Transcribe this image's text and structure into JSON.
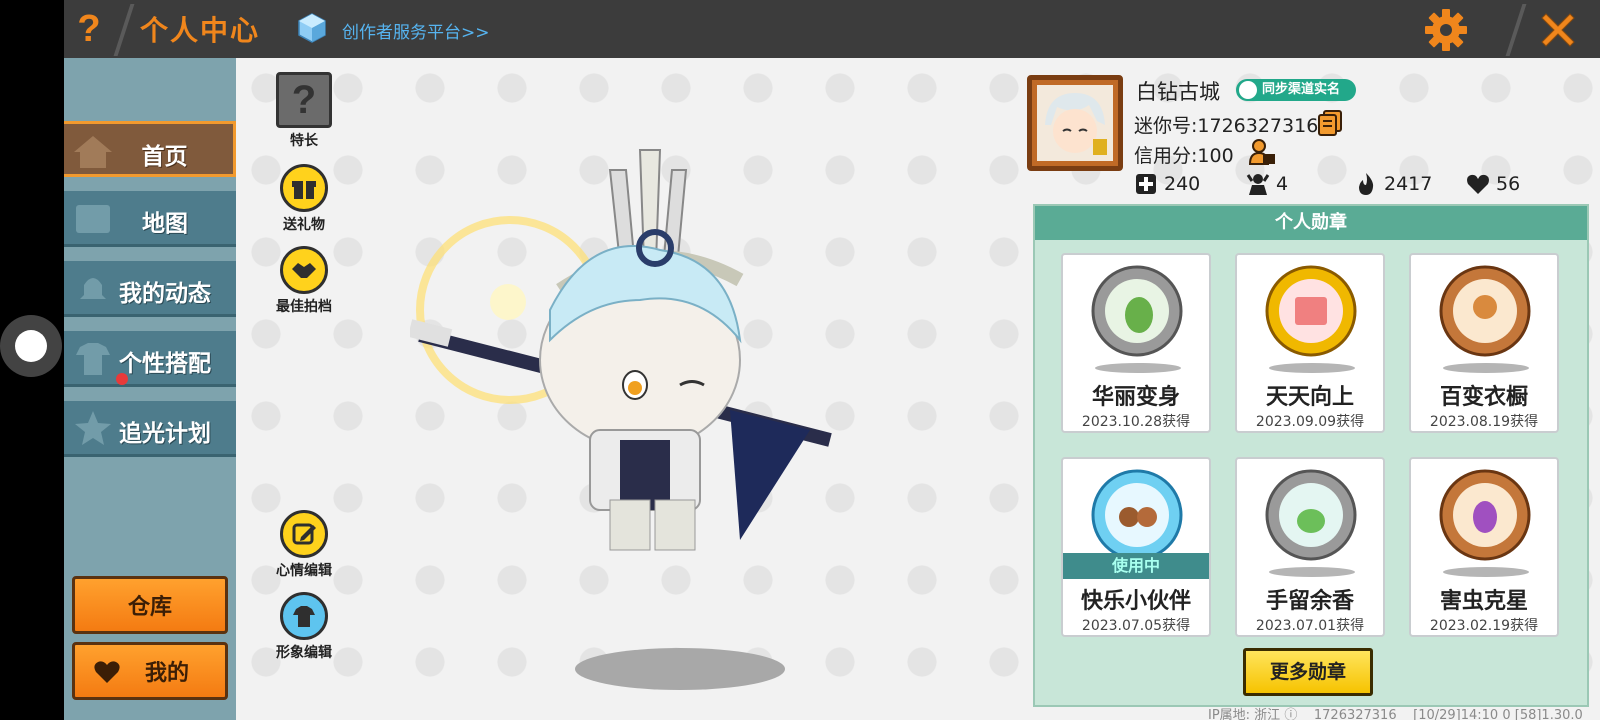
{
  "header": {
    "help": "?",
    "title": "个人中心",
    "creator_link": "创作者服务平台>>"
  },
  "sidebar": {
    "items": [
      {
        "label": "首页",
        "active": true
      },
      {
        "label": "地图",
        "active": false
      },
      {
        "label": "我的动态",
        "active": false
      },
      {
        "label": "个性搭配",
        "active": false
      },
      {
        "label": "追光计划",
        "active": false
      }
    ],
    "warehouse": "仓库",
    "mine": "我的"
  },
  "tools": {
    "talent": "特长",
    "gift": "送礼物",
    "partner": "最佳拍档",
    "mood": "心情编辑",
    "avatar_edit": "形象编辑"
  },
  "profile": {
    "nickname": "白钻古城",
    "realname_badge": "同步渠道实名",
    "mini_id": "迷你号:1726327316",
    "credit": "信用分:100",
    "stats": {
      "fans_add": "240",
      "follow": "4",
      "hot": "2417",
      "likes": "56"
    }
  },
  "medals": {
    "title": "个人勋章",
    "items": [
      {
        "name": "华丽变身",
        "date": "2023.10.28获得",
        "tier": "silver",
        "in_use": false
      },
      {
        "name": "天天向上",
        "date": "2023.09.09获得",
        "tier": "gold",
        "in_use": false
      },
      {
        "name": "百变衣橱",
        "date": "2023.08.19获得",
        "tier": "bronze",
        "in_use": false
      },
      {
        "name": "快乐小伙伴",
        "date": "2023.07.05获得",
        "tier": "crystal",
        "in_use": true
      },
      {
        "name": "手留余香",
        "date": "2023.07.01获得",
        "tier": "silver",
        "in_use": false
      },
      {
        "name": "害虫克星",
        "date": "2023.02.19获得",
        "tier": "bronze",
        "in_use": false
      }
    ],
    "in_use_label": "使用中",
    "more": "更多勋章"
  },
  "footer": {
    "ip": "IP属地: 浙江",
    "uid": "1726327316",
    "time": "[10/29]14:10 0",
    "version": "[58]1.30.0"
  },
  "colors": {
    "accent_orange": "#f0861c",
    "sidebar_blue": "#4e7c8c",
    "medal_green": "#5aab95",
    "creator_blue": "#56b4f0"
  }
}
